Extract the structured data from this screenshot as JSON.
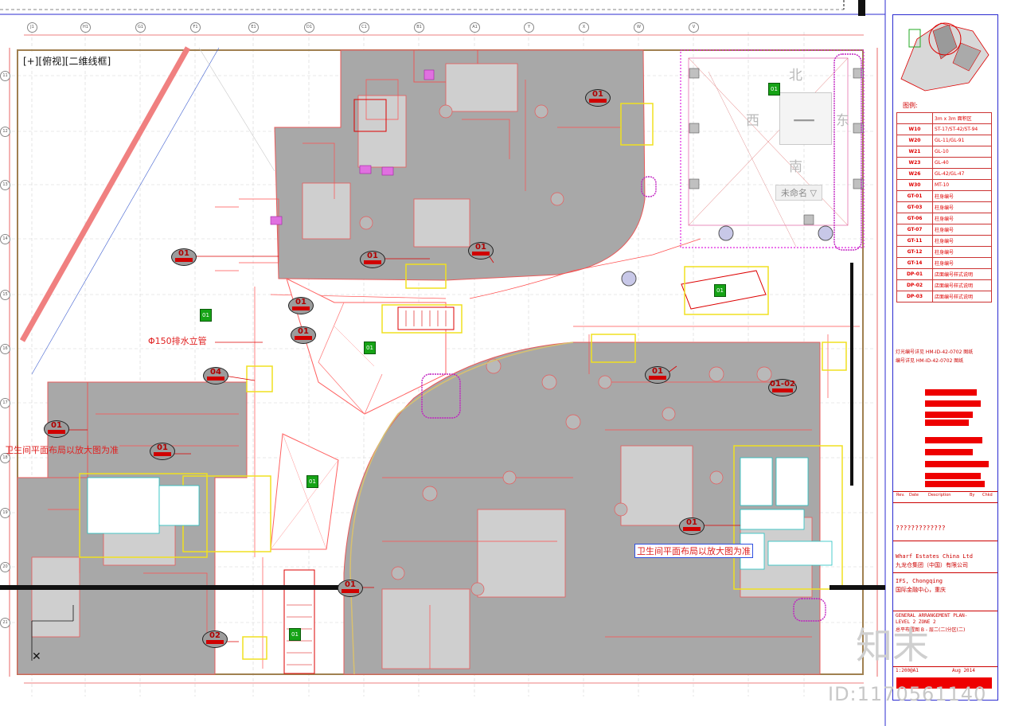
{
  "viewport": {
    "label": "[+][俯视][二维线框]"
  },
  "compass": {
    "north": "北",
    "west": "西",
    "east": "东",
    "south": "南",
    "center": "一",
    "unnamed": "未命名 ▽"
  },
  "annotations": {
    "drain_pipe": "Φ150排水立管",
    "toilet_note_left": "卫生间平面布局以放大图为准",
    "toilet_note_right": "卫生间平面布局以放大图为准"
  },
  "grid_axes": {
    "top": [
      "J1",
      "H1",
      "G1",
      "F1",
      "E1",
      "D1",
      "C1",
      "B1",
      "A1",
      "Y",
      "X",
      "W",
      "V"
    ],
    "left": [
      "11",
      "12",
      "13",
      "14",
      "15",
      "16",
      "17",
      "18",
      "19",
      "20",
      "21",
      "22"
    ]
  },
  "tags": [
    {
      "id": "01"
    },
    {
      "id": "01"
    },
    {
      "id": "01"
    },
    {
      "id": "01"
    },
    {
      "id": "01"
    },
    {
      "id": "01"
    },
    {
      "id": "01"
    },
    {
      "id": "04"
    },
    {
      "id": "01"
    },
    {
      "id": "01"
    },
    {
      "id": "01-02"
    },
    {
      "id": "01"
    },
    {
      "id": "01"
    },
    {
      "id": "02"
    },
    {
      "id": "01"
    }
  ],
  "green_tags": [
    "01",
    "01",
    "01",
    "01",
    "01",
    "01"
  ],
  "title_block": {
    "legend_title": "图例:",
    "legend_header": "3m x 3m 面积区",
    "legend": [
      {
        "code": "W10",
        "desc": "ST-17/ST-42/ST-94"
      },
      {
        "code": "W20",
        "desc": "GL-11/GL-91"
      },
      {
        "code": "W21",
        "desc": "GL-10"
      },
      {
        "code": "W23",
        "desc": "GL-40"
      },
      {
        "code": "W26",
        "desc": "GL-42/GL-47"
      },
      {
        "code": "W30",
        "desc": "MT-10"
      },
      {
        "code": "GT-01",
        "desc": "柱身编号"
      },
      {
        "code": "GT-03",
        "desc": "柱身编号"
      },
      {
        "code": "GT-06",
        "desc": "柱身编号"
      },
      {
        "code": "GT-07",
        "desc": "柱身编号"
      },
      {
        "code": "GT-11",
        "desc": "柱身编号"
      },
      {
        "code": "GT-12",
        "desc": "柱身编号"
      },
      {
        "code": "GT-14",
        "desc": "柱身编号"
      },
      {
        "code": "DP-01",
        "desc": "店面编号样式说明"
      },
      {
        "code": "DP-02",
        "desc": "店面编号样式说明"
      },
      {
        "code": "DP-03",
        "desc": "店面编号样式说明"
      }
    ],
    "ref_note_1": "灯光编号详见 HM-ID-42-0702 图纸",
    "ref_note_2": "编号详见 HM-ID-42-0702 图纸",
    "rev_headers": [
      "Rev.",
      "Date",
      "Description",
      "By",
      "Chkd"
    ],
    "company_en": "Wharf Estates China Ltd",
    "company_cn": "九龙仓集团（中国）有限公司",
    "project_en": "IFS, Chongqing",
    "project_cn": "国际金融中心，重庆",
    "drawing_title_1": "GENERAL ARRANGEMENT PLAN-",
    "drawing_title_2": "LEVEL 2 ZONE 2",
    "drawing_title_cn": "总平布置图 B - 层二(二)分区(二)",
    "scale": "1:200@A1",
    "date": "Aug 2014",
    "logo_text": "?????????????"
  },
  "watermark": {
    "id": "ID:1170561140",
    "brand": "知末"
  }
}
